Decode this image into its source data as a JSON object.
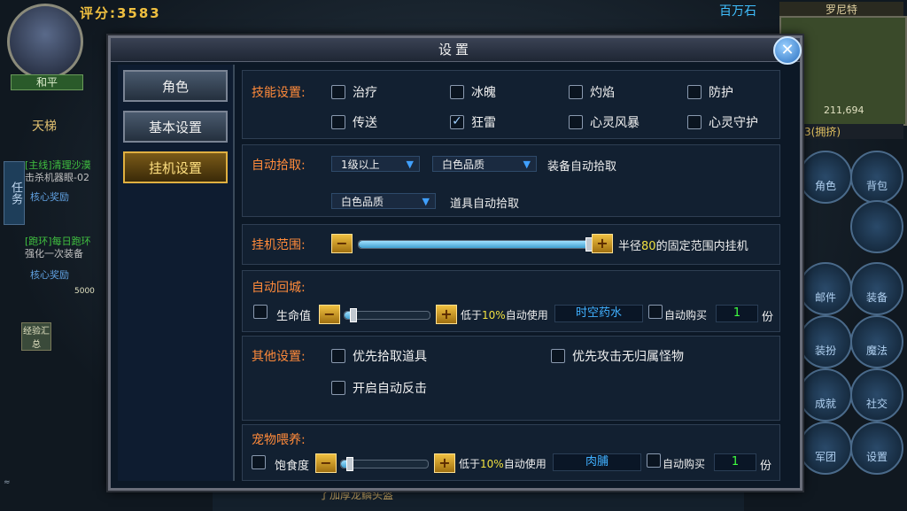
{
  "hud": {
    "score_label": "评分:",
    "score_value": "3583",
    "peace_mode": "和平",
    "ladder": "天梯",
    "quest1_title": "[主线]清理沙漠",
    "quest1_desc": "击杀机器眼-02",
    "quest1_reward": "核心奖励",
    "quest2_title": "[跑环]每日跑环",
    "quest2_desc": "强化一次装备",
    "quest2_reward": "核心奖励",
    "reward_amount": "5000",
    "side_tab": "任务",
    "exp_summary": "经验汇总",
    "million": "百万石",
    "minimap_title": "罗尼特",
    "minimap_coords": "211,694",
    "line_info": "线路:3(拥挤)",
    "bottom_msg": "了加厚龙鳞头盔",
    "right_buttons": [
      "角色",
      "背包",
      "",
      "邮件",
      "装备",
      "装扮",
      "魔法",
      "成就",
      "社交",
      "军团",
      "设置"
    ]
  },
  "dialog": {
    "title": "设置",
    "close_icon": "close-icon",
    "nav": [
      "角色",
      "基本设置",
      "挂机设置"
    ],
    "active_nav": "挂机设置",
    "skills": {
      "label": "技能设置:",
      "options": [
        {
          "name": "治疗",
          "checked": false
        },
        {
          "name": "冰魄",
          "checked": false
        },
        {
          "name": "灼焰",
          "checked": false
        },
        {
          "name": "防护",
          "checked": false
        },
        {
          "name": "传送",
          "checked": false
        },
        {
          "name": "狂雷",
          "checked": true
        },
        {
          "name": "心灵风暴",
          "checked": false
        },
        {
          "name": "心灵守护",
          "checked": false
        }
      ]
    },
    "pickup": {
      "label": "自动拾取:",
      "level_select": "1级以上",
      "quality_select": "白色品质",
      "equip_text": "装备自动拾取",
      "item_quality_select": "白色品质",
      "item_text": "道具自动拾取"
    },
    "range": {
      "label": "挂机范围:",
      "text_prefix": "半径",
      "radius": "80",
      "text_suffix": "的固定范围内挂机",
      "slider_fraction": 1.0
    },
    "return": {
      "label": "自动回城:",
      "hp_label": "生命值",
      "below": "低于",
      "percent": "10%",
      "auto_use": "自动使用",
      "potion": "时空药水",
      "auto_buy": "自动购买",
      "qty": "1",
      "unit": "份",
      "slider_fraction": 0.1
    },
    "other": {
      "label": "其他设置:",
      "opt1": "优先拾取道具",
      "opt2": "优先攻击无归属怪物",
      "opt3": "开启自动反击"
    },
    "pet": {
      "label": "宠物喂养:",
      "food_label": "饱食度",
      "below": "低于",
      "percent": "10%",
      "auto_use": "自动使用",
      "food": "肉脯",
      "auto_buy": "自动购买",
      "qty": "1",
      "unit": "份",
      "slider_fraction": 0.1
    }
  }
}
